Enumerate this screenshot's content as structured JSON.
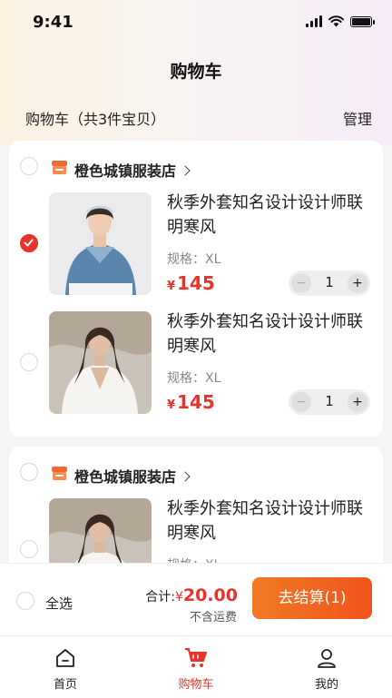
{
  "status": {
    "time": "9:41"
  },
  "header": {
    "title": "购物车",
    "cart_count": "购物车（共3件宝贝）",
    "manage": "管理"
  },
  "shops": [
    {
      "name": "橙色城镇服装店",
      "items": [
        {
          "title": "秋季外套知名设计设计师联明寒风",
          "spec": "规格：XL",
          "currency": "¥",
          "price": "145",
          "qty": "1",
          "checked": true
        },
        {
          "title": "秋季外套知名设计设计师联明寒风",
          "spec": "规格：XL",
          "currency": "¥",
          "price": "145",
          "qty": "1",
          "checked": false
        }
      ]
    },
    {
      "name": "橙色城镇服装店",
      "items": [
        {
          "title": "秋季外套知名设计设计师联明寒风",
          "spec": "规格：XL",
          "checked": false
        }
      ]
    }
  ],
  "stepper": {
    "minus": "−",
    "plus": "+"
  },
  "footer": {
    "select_all": "全选",
    "total_label": "合计:",
    "currency": "¥",
    "total_amount": "20.00",
    "shipping_note": "不含运费",
    "checkout": "去结算(1)"
  },
  "tabs": [
    {
      "label": "首页",
      "icon": "home-icon",
      "active": false
    },
    {
      "label": "购物车",
      "icon": "cart-icon",
      "active": true
    },
    {
      "label": "我的",
      "icon": "user-icon",
      "active": false
    }
  ],
  "colors": {
    "accent": "#e8332a",
    "checkout_start": "#f07a24",
    "checkout_end": "#f0541d",
    "shop_icon": "#f26b36"
  }
}
